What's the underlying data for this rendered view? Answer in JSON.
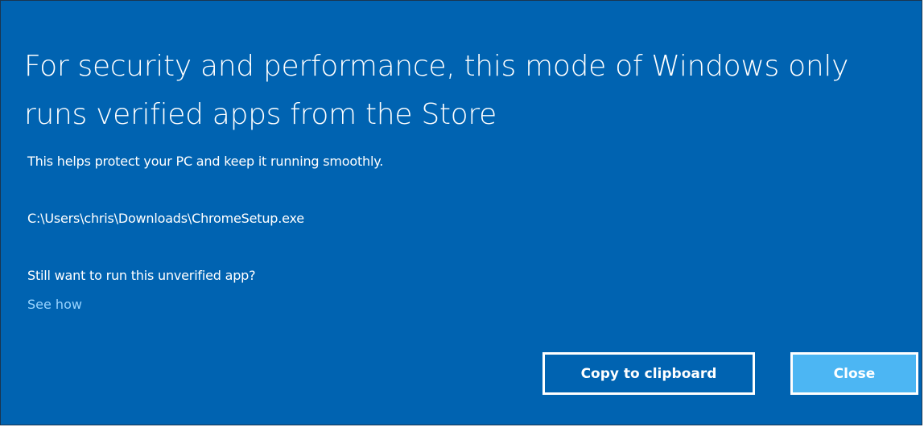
{
  "dialog": {
    "title": "For security and performance, this mode of Windows only runs verified apps from the Store",
    "subtitle": "This helps protect your PC and keep it running smoothly.",
    "file_path": "C:\\Users\\chris\\Downloads\\ChromeSetup.exe",
    "question": "Still want to run this unverified app?",
    "see_how_link": "See how",
    "copy_button_label": "Copy to clipboard",
    "close_button_label": "Close",
    "colors": {
      "background": "#0063b1",
      "link": "#99d4ff",
      "close_button": "#4cb6f3"
    }
  }
}
